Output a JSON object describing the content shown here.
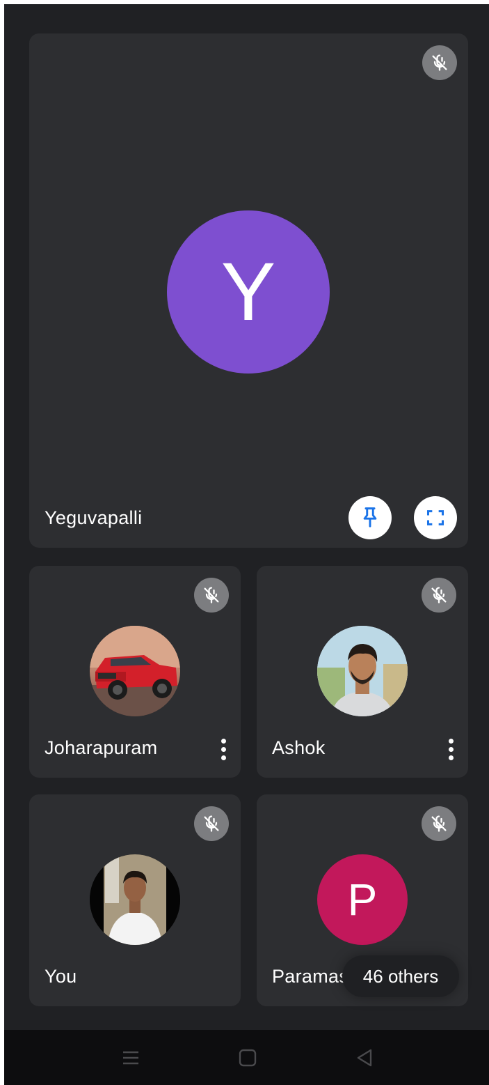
{
  "colors": {
    "background": "#202124",
    "tile": "#2d2e31",
    "mute_badge": "#7c7d80",
    "accent_blue": "#1a73e8",
    "avatar_purple": "#7e4fd0",
    "avatar_pink": "#c2185b"
  },
  "main_tile": {
    "avatar_letter": "Y",
    "name": "Yeguvapalli",
    "mic_icon": "mic-off-icon",
    "pin_icon": "pin-icon",
    "fullscreen_icon": "fullscreen-icon"
  },
  "tiles": [
    {
      "name": "Joharapuram",
      "avatar": "red-truck-photo",
      "mic_icon": "mic-off-icon",
      "menu_icon": "more-vert-icon"
    },
    {
      "name": "Ashok",
      "avatar": "man-portrait-photo",
      "mic_icon": "mic-off-icon",
      "menu_icon": "more-vert-icon"
    },
    {
      "name": "You",
      "avatar": "man-white-shirt-photo",
      "mic_icon": "mic-off-icon"
    },
    {
      "name": "Paramasi",
      "avatar_letter": "P",
      "mic_icon": "mic-off-icon"
    }
  ],
  "others_chip": {
    "label": "46 others"
  },
  "nav_bar": {
    "items": [
      "menu-icon",
      "home-square-icon",
      "back-triangle-icon"
    ]
  }
}
